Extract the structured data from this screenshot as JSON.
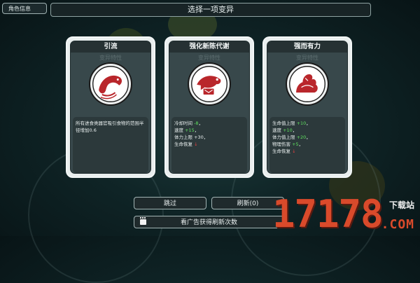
{
  "top": {
    "role_info_label": "角色信息",
    "header_title": "选择一项变异"
  },
  "cards": [
    {
      "title": "引流",
      "subtitle": "变异特性",
      "icon": "swirl-fish-icon",
      "description": "所有进食类器官吸引食物的范围半径增加0.6"
    },
    {
      "title": "强化新陈代谢",
      "subtitle": "变异特性",
      "icon": "metabolism-fish-icon",
      "stats": [
        {
          "label": "冷却时间 ",
          "value": "-8",
          "color": "pos",
          "suffix": "，"
        },
        {
          "label": "速度 ",
          "value": "+15",
          "color": "pos",
          "suffix": "，"
        },
        {
          "label": "体力上限 ",
          "value": "+30",
          "color": "neu",
          "suffix": "，"
        },
        {
          "label": "生命恢复 ",
          "value": "↓",
          "color": "neg",
          "suffix": ""
        }
      ]
    },
    {
      "title": "强而有力",
      "subtitle": "变异特性",
      "icon": "flexed-arm-icon",
      "stats": [
        {
          "label": "生命值上限 ",
          "value": "+10",
          "color": "pos",
          "suffix": "，"
        },
        {
          "label": "速度 ",
          "value": "+10",
          "color": "pos",
          "suffix": "，"
        },
        {
          "label": "体力值上限 ",
          "value": "+20",
          "color": "pos",
          "suffix": "，"
        },
        {
          "label": "物理伤害 ",
          "value": "+5",
          "color": "pos",
          "suffix": "，"
        },
        {
          "label": "生命恢复 ",
          "value": "↓",
          "color": "neg",
          "suffix": ""
        }
      ]
    }
  ],
  "buttons": {
    "skip": "跳过",
    "refresh": "刷新(0)",
    "ad_refresh": "看广告获得刷新次数"
  },
  "watermark": {
    "number": "17178",
    "site": "下载站",
    "domain": ".COM"
  },
  "colors": {
    "positive": "#5fe05f",
    "negative": "#e34141",
    "card_frame": "#e9eeee",
    "icon_red": "#b9262b"
  }
}
